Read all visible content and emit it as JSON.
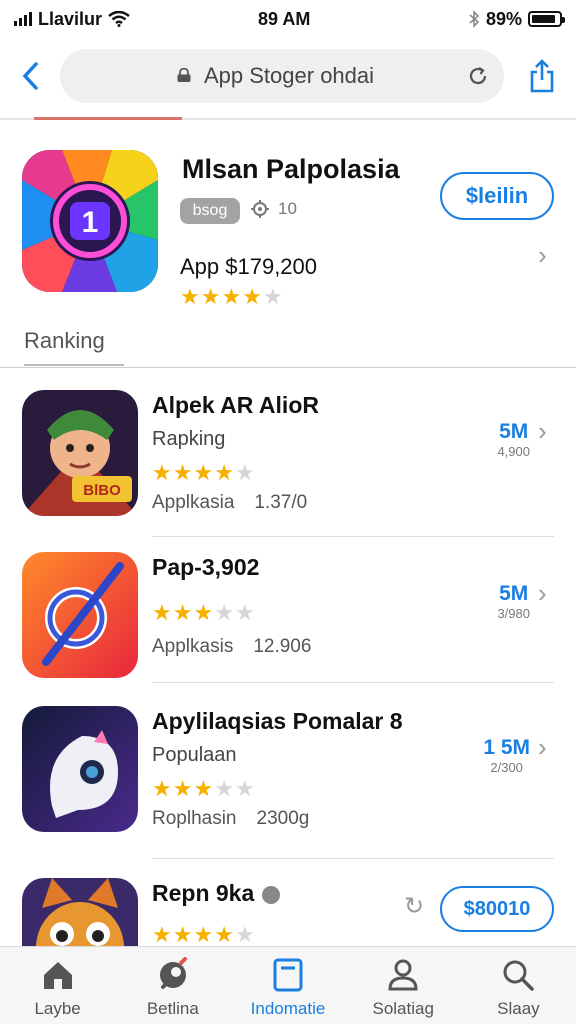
{
  "status_bar": {
    "carrier": "Llavilur",
    "time": "89 AM",
    "battery": "89%",
    "battery_level": 0.89
  },
  "address_bar": {
    "url": "App Stoger ohdai"
  },
  "featured": {
    "title": "Mlsan Palpolasia",
    "badge": "bsog",
    "meta": "10",
    "price": "App $179,200",
    "rating": 4,
    "get_label": "$leilin"
  },
  "section": {
    "header": "Ranking"
  },
  "apps": [
    {
      "title": "Alpek AR AlioR",
      "subtitle": "Rapking",
      "rating": 4,
      "category": "Applkasia",
      "count": "1.37/0",
      "size": "5M",
      "size_sub": "4,900",
      "icon_text": "BlBO"
    },
    {
      "title": "Pap-3,902",
      "subtitle": "",
      "rating": 3,
      "category": "Applkasis",
      "count": "12.906",
      "size": "5M",
      "size_sub": "3/980"
    },
    {
      "title": "Apylilaqsias Pomalar 8",
      "subtitle": "Populaan",
      "rating": 3,
      "category": "Roplhasin",
      "count": "2300g",
      "size": "1 5M",
      "size_sub": "2/300"
    },
    {
      "title": "Repn 9ka",
      "rating": 4,
      "get_label": "$80010"
    }
  ],
  "tabs": [
    {
      "label": "Laybe",
      "icon": "home-icon"
    },
    {
      "label": "Betlina",
      "icon": "rocket-icon"
    },
    {
      "label": "Indomatie",
      "icon": "today-icon"
    },
    {
      "label": "Solatiag",
      "icon": "person-icon"
    },
    {
      "label": "Slaay",
      "icon": "search-icon"
    }
  ],
  "colors": {
    "accent": "#1a7fe0",
    "star": "#f5b000"
  }
}
